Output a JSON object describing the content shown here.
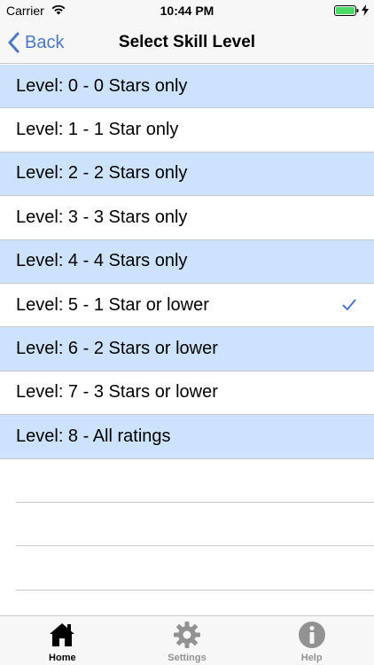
{
  "status_bar": {
    "carrier": "Carrier",
    "time": "10:44 PM"
  },
  "nav": {
    "back_label": "Back",
    "title": "Select Skill Level"
  },
  "levels": [
    {
      "label": "Level: 0 - 0 Stars only",
      "selected": false
    },
    {
      "label": "Level: 1 - 1 Star only",
      "selected": false
    },
    {
      "label": "Level: 2 - 2 Stars only",
      "selected": false
    },
    {
      "label": "Level: 3 - 3 Stars only",
      "selected": false
    },
    {
      "label": "Level: 4 - 4 Stars only",
      "selected": false
    },
    {
      "label": "Level: 5 - 1 Star or lower",
      "selected": true
    },
    {
      "label": "Level: 6 - 2 Stars or lower",
      "selected": false
    },
    {
      "label": "Level: 7 - 3 Stars or lower",
      "selected": false
    },
    {
      "label": "Level: 8 - All ratings",
      "selected": false
    }
  ],
  "tabs": [
    {
      "label": "Home",
      "icon": "home-icon",
      "active": true
    },
    {
      "label": "Settings",
      "icon": "gear-icon",
      "active": false
    },
    {
      "label": "Help",
      "icon": "info-icon",
      "active": false
    }
  ],
  "colors": {
    "accent": "#4a78c4",
    "alt_row": "#cde2fc",
    "battery": "#4cd964"
  }
}
